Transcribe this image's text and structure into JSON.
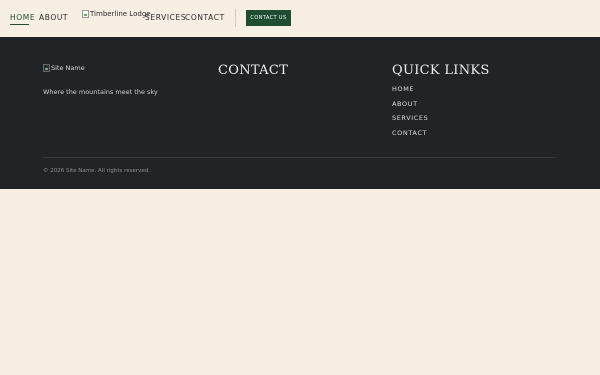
{
  "header": {
    "nav": {
      "home": "HOME",
      "about": "ABOUT",
      "services": "SERVICES",
      "contact": "CONTACT"
    },
    "logo_alt": "Timberline Lodge",
    "cta_label": "CONTACT US",
    "active_nav": "home"
  },
  "footer": {
    "logo_alt": "Site Name",
    "tagline": "Where the mountains meet the sky",
    "contact_heading": "CONTACT",
    "quick_links_heading": "QUICK LINKS",
    "quick_links": [
      "HOME",
      "ABOUT",
      "SERVICES",
      "CONTACT"
    ],
    "copyright": "© 2026 Site Name. All rights reserved."
  },
  "colors": {
    "page_background": "#f7efe4",
    "footer_background": "#202427",
    "accent_green": "#1e4d31"
  },
  "icons": {
    "logo": "broken-image-icon",
    "footer_logo": "broken-image-icon"
  }
}
